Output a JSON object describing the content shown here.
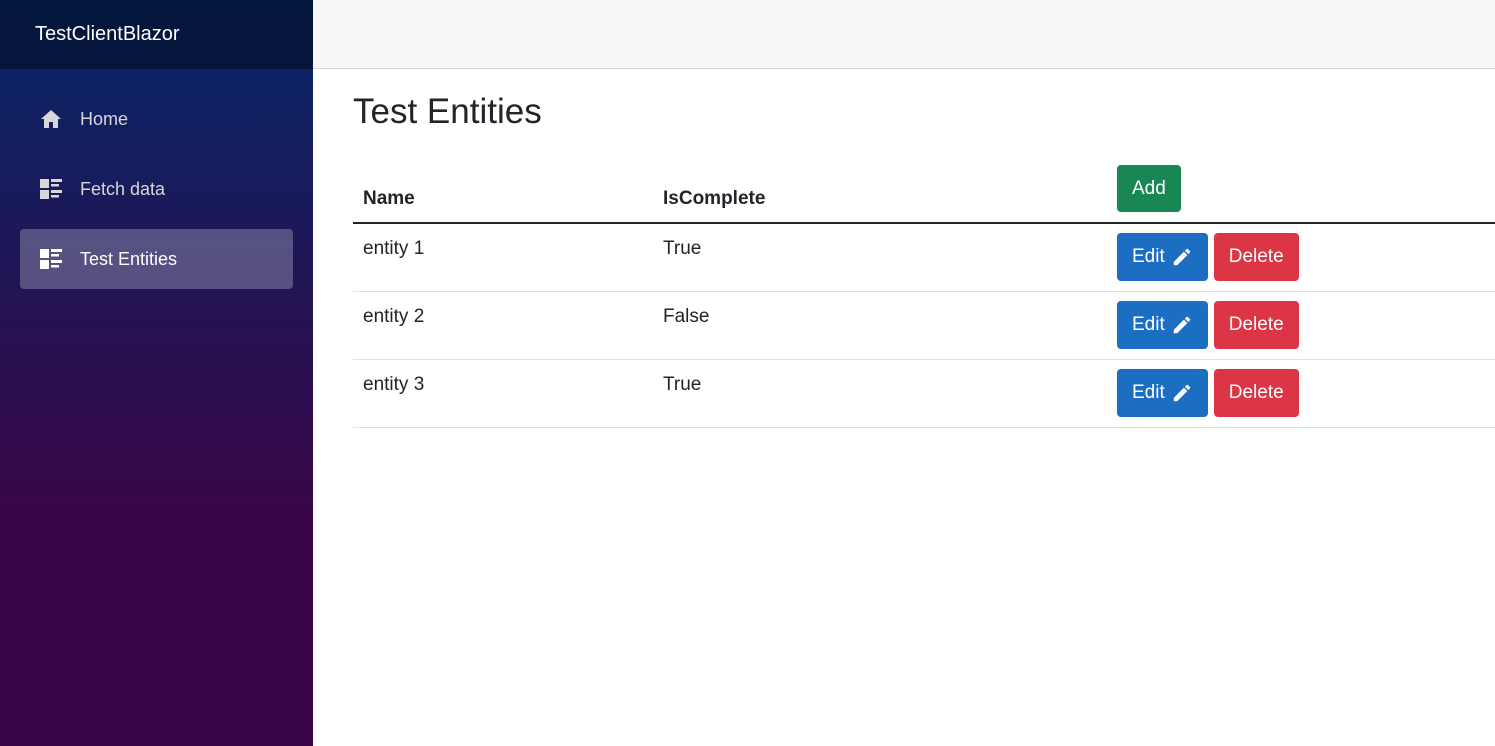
{
  "sidebar": {
    "brand": "TestClientBlazor",
    "items": [
      {
        "label": "Home",
        "icon": "home-icon",
        "active": false
      },
      {
        "label": "Fetch data",
        "icon": "list-rich-icon",
        "active": false
      },
      {
        "label": "Test Entities",
        "icon": "list-rich-icon",
        "active": true
      }
    ]
  },
  "main": {
    "title": "Test Entities",
    "table": {
      "headers": {
        "name": "Name",
        "is_complete": "IsComplete"
      },
      "add_label": "Add",
      "edit_label": "Edit",
      "delete_label": "Delete",
      "rows": [
        {
          "name": "entity 1",
          "is_complete": "True"
        },
        {
          "name": "entity 2",
          "is_complete": "False"
        },
        {
          "name": "entity 3",
          "is_complete": "True"
        }
      ]
    }
  },
  "colors": {
    "sidebar_top": "#052767",
    "sidebar_bottom": "#3a0647",
    "add": "#198754",
    "edit": "#1b6ec2",
    "delete": "#dc3545"
  }
}
